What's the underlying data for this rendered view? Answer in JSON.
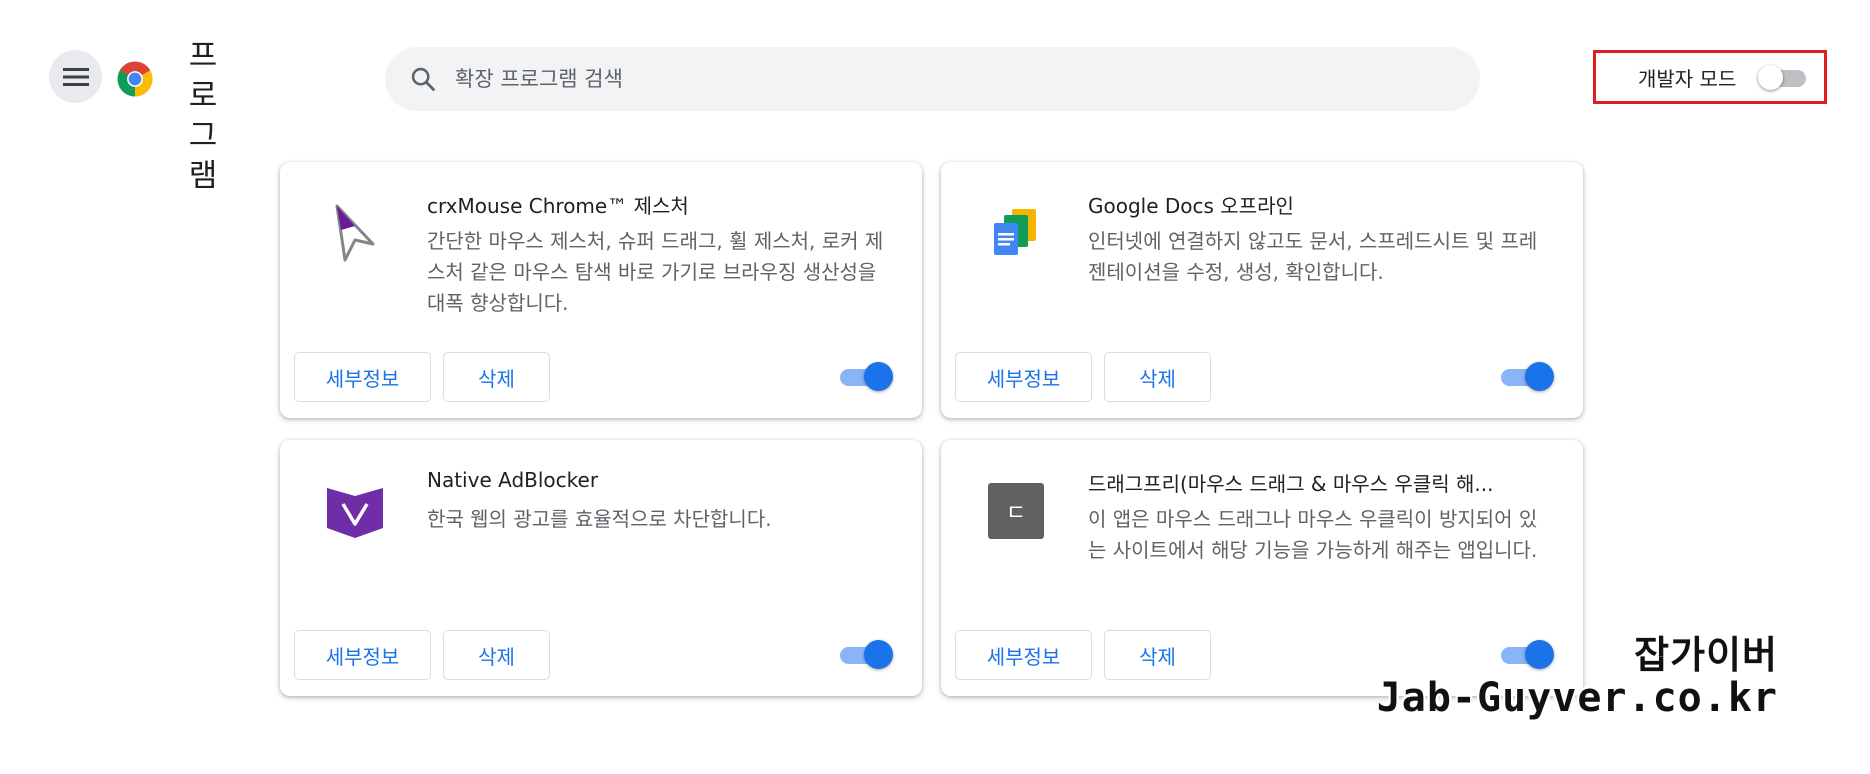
{
  "header": {
    "title": "프로그램",
    "search_placeholder": "확장 프로그램 검색",
    "dev_mode_label": "개발자 모드",
    "dev_mode_on": false
  },
  "extensions": [
    {
      "name": "crxMouse Chrome™ 제스처",
      "description": "간단한 마우스 제스처, 슈퍼 드래그, 휠 제스처, 로커 제스처 같은 마우스 탐색 바로 가기로 브라우징 생산성을 대폭 향상합니다.",
      "details_label": "세부정보",
      "remove_label": "삭제",
      "enabled": true,
      "icon": "cursor-arrow-icon"
    },
    {
      "name": "Google Docs 오프라인",
      "description": "인터넷에 연결하지 않고도 문서, 스프레드시트 및 프레젠테이션을 수정, 생성, 확인합니다.",
      "details_label": "세부정보",
      "remove_label": "삭제",
      "enabled": true,
      "icon": "google-docs-icon"
    },
    {
      "name": "Native AdBlocker",
      "description": "한국 웹의 광고를 효율적으로 차단합니다.",
      "details_label": "세부정보",
      "remove_label": "삭제",
      "enabled": true,
      "icon": "adblocker-shield-icon"
    },
    {
      "name": "드래그프리(마우스 드래그 & 마우스 우클릭 해...",
      "description": "이 앱은 마우스 드래그나 마우스 우클릭이 방지되어 있는 사이트에서 해당 기능을 가능하게 해주는 앱입니다.",
      "details_label": "세부정보",
      "remove_label": "삭제",
      "enabled": true,
      "icon": "dragfree-icon",
      "icon_glyph": "ㄷ"
    }
  ],
  "watermark": {
    "line1": "잡가이버",
    "line2": "Jab-Guyver.co.kr"
  },
  "colors": {
    "accent": "#1a73e8",
    "highlight_box": "#e01e1e",
    "search_bg": "#f1f3f4"
  }
}
